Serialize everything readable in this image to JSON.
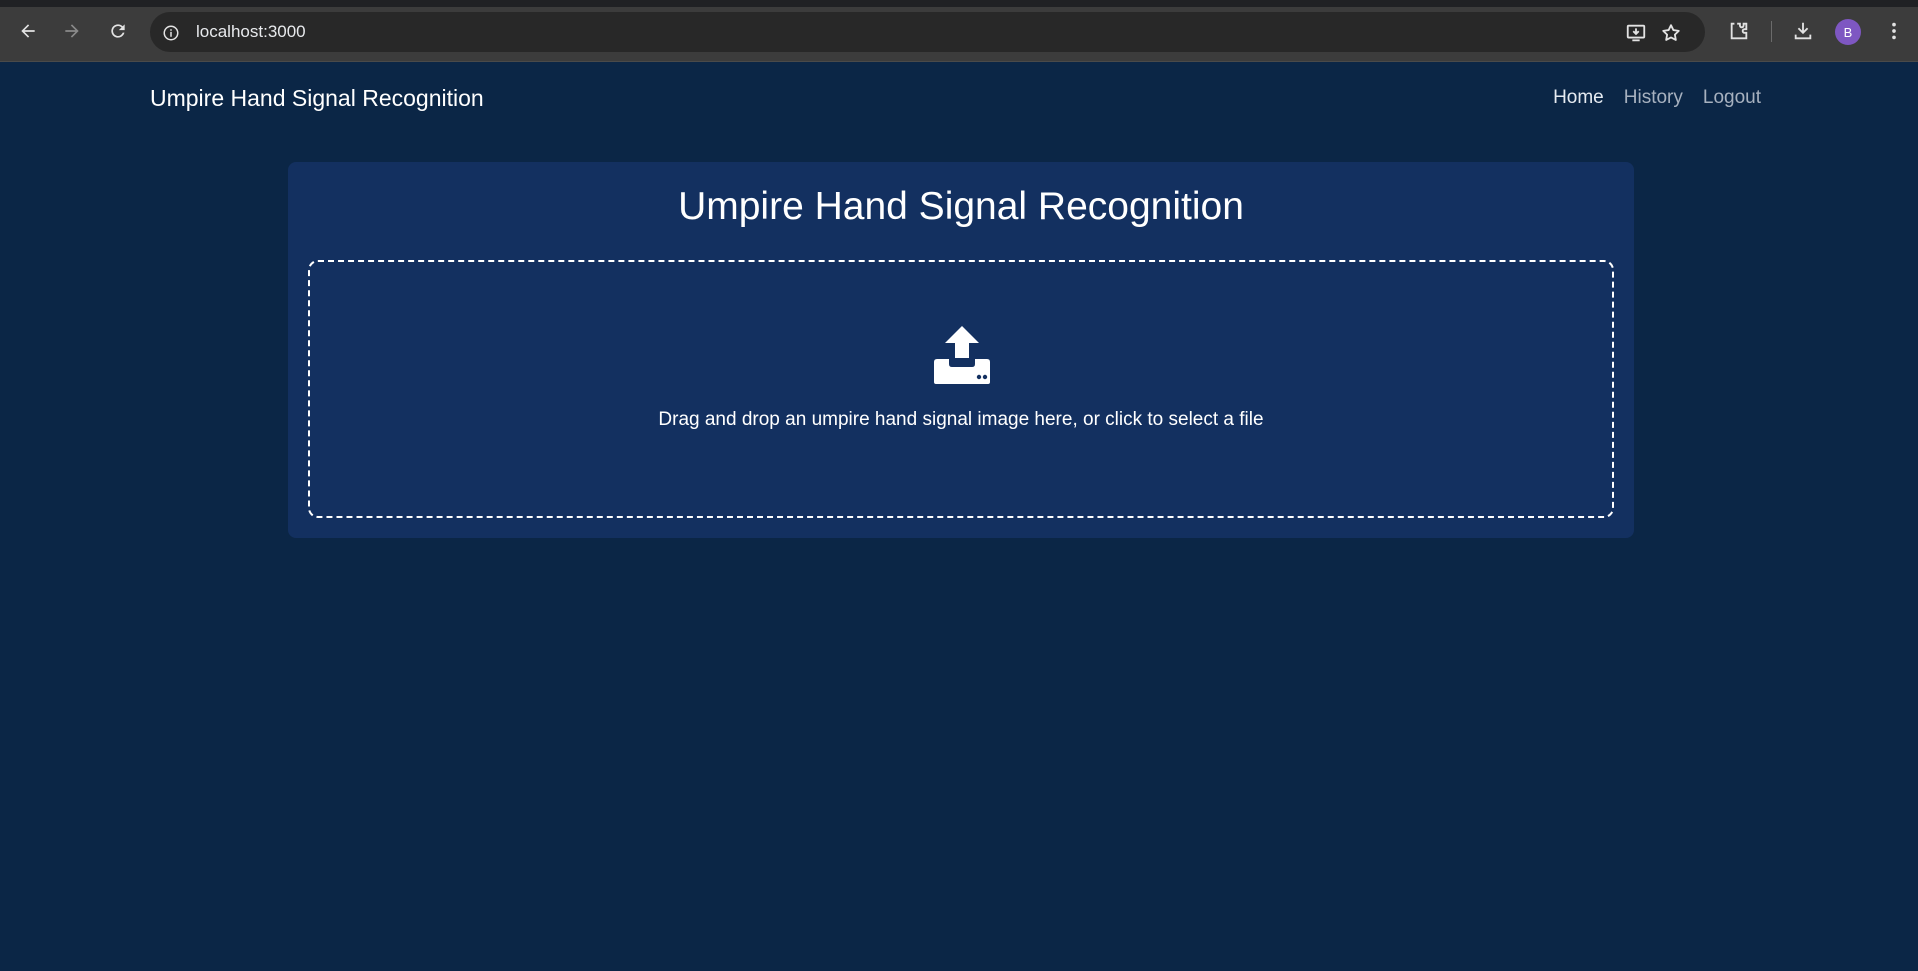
{
  "browser": {
    "url": "localhost:3000",
    "profile_initial": "B",
    "profile_color": "#7e57c2"
  },
  "navbar": {
    "brand": "Umpire Hand Signal Recognition",
    "links": [
      {
        "label": "Home",
        "active": true
      },
      {
        "label": "History",
        "active": false
      },
      {
        "label": "Logout",
        "active": false
      }
    ]
  },
  "main": {
    "title": "Umpire Hand Signal Recognition",
    "dropzone": {
      "icon": "upload-icon",
      "text": "Drag and drop an umpire hand signal image here, or click to select a file"
    }
  },
  "colors": {
    "page_background": "#0b2646",
    "card_background": "#133060",
    "text": "#ffffff",
    "nav_inactive": "#a7b1bf"
  }
}
